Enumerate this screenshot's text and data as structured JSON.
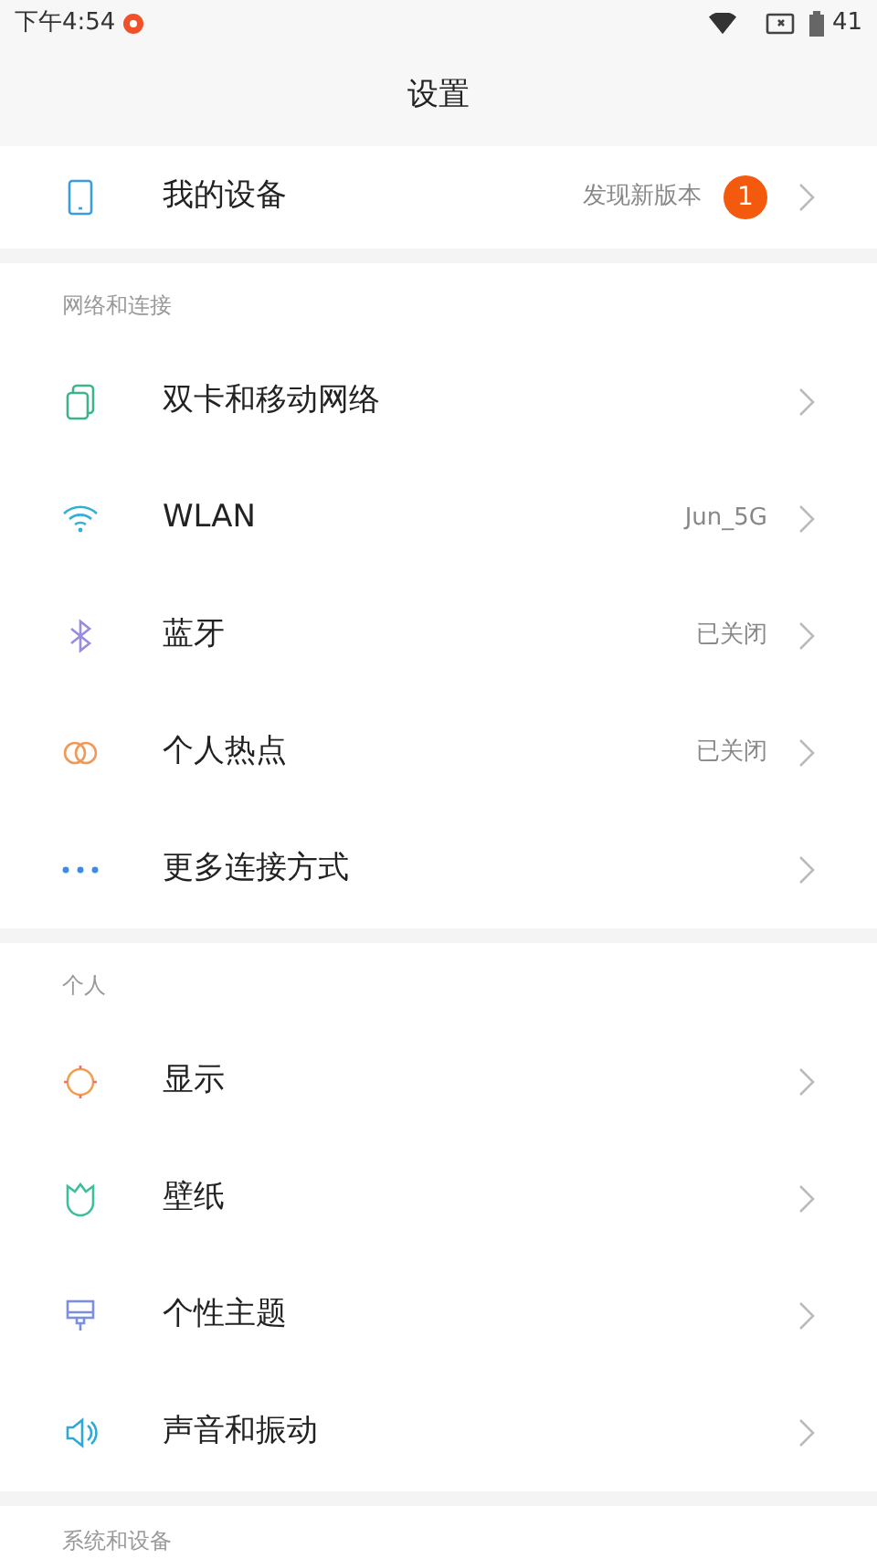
{
  "status_bar": {
    "time": "下午4:54",
    "battery": "41"
  },
  "title": "设置",
  "top_item": {
    "label": "我的设备",
    "value": "发现新版本",
    "badge": "1"
  },
  "sections": [
    {
      "header": "网络和连接",
      "items": [
        {
          "label": "双卡和移动网络"
        },
        {
          "label": "WLAN",
          "value": "Jun_5G"
        },
        {
          "label": "蓝牙",
          "value": "已关闭"
        },
        {
          "label": "个人热点",
          "value": "已关闭"
        },
        {
          "label": "更多连接方式"
        }
      ]
    },
    {
      "header": "个人",
      "items": [
        {
          "label": "显示"
        },
        {
          "label": "壁纸"
        },
        {
          "label": "个性主题"
        },
        {
          "label": "声音和振动"
        }
      ]
    },
    {
      "header": "系统和设备"
    }
  ]
}
